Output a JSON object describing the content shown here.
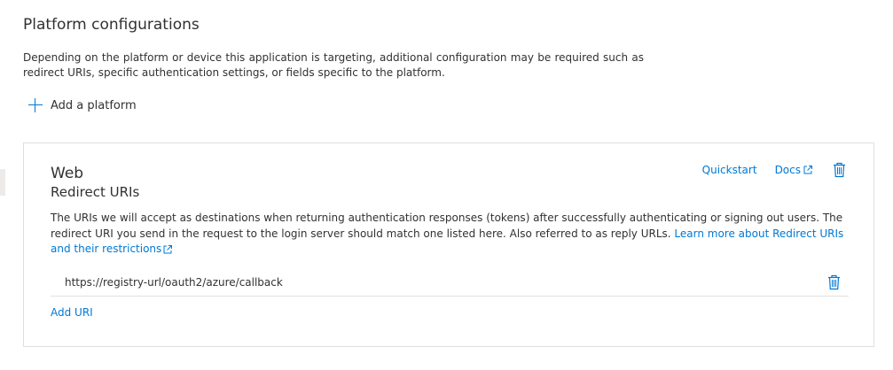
{
  "section": {
    "title": "Platform configurations",
    "description": "Depending on the platform or device this application is targeting, additional configuration may be required such as redirect URIs, specific authentication settings, or fields specific to the platform.",
    "add_platform_label": "Add a platform"
  },
  "web_card": {
    "title": "Web",
    "subtitle": "Redirect URIs",
    "quickstart_label": "Quickstart",
    "docs_label": "Docs",
    "description": "The URIs we will accept as destinations when returning authentication responses (tokens) after successfully authenticating or signing out users. The redirect URI you send in the request to the login server should match one listed here. Also referred to as reply URLs.",
    "learn_more_label": "Learn more about Redirect URIs and their restrictions",
    "redirect_uris": [
      "https://registry-url/oauth2/azure/callback"
    ],
    "add_uri_label": "Add URI"
  },
  "icons": {
    "add": "plus-icon",
    "delete": "trash-icon",
    "external": "external-link-icon"
  },
  "colors": {
    "accent": "#0078d4",
    "text": "#323130",
    "border": "#e1dfdd"
  }
}
